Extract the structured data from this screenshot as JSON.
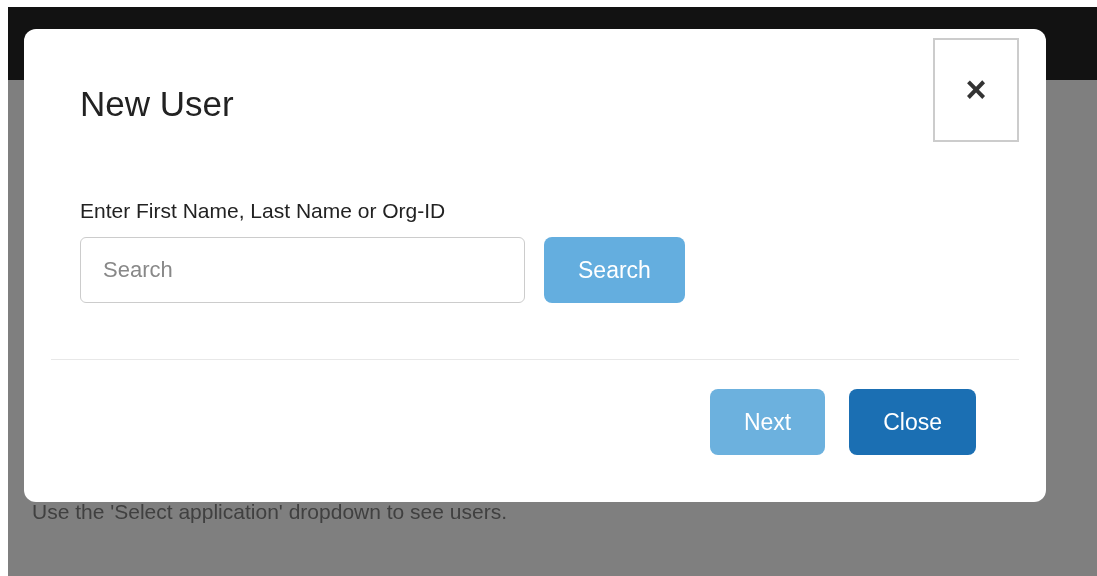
{
  "page": {
    "hint": "Use the 'Select application' dropdown to see users."
  },
  "modal": {
    "title": "New User",
    "close_icon": "×",
    "field_label": "Enter First Name, Last Name or Org-ID",
    "search": {
      "placeholder": "Search"
    },
    "search_button": {
      "label": "Search",
      "disabled": true
    },
    "buttons": [
      {
        "label": "Next",
        "kind": "primary",
        "disabled": true
      },
      {
        "label": "Close",
        "kind": "primary",
        "disabled": false
      }
    ]
  }
}
